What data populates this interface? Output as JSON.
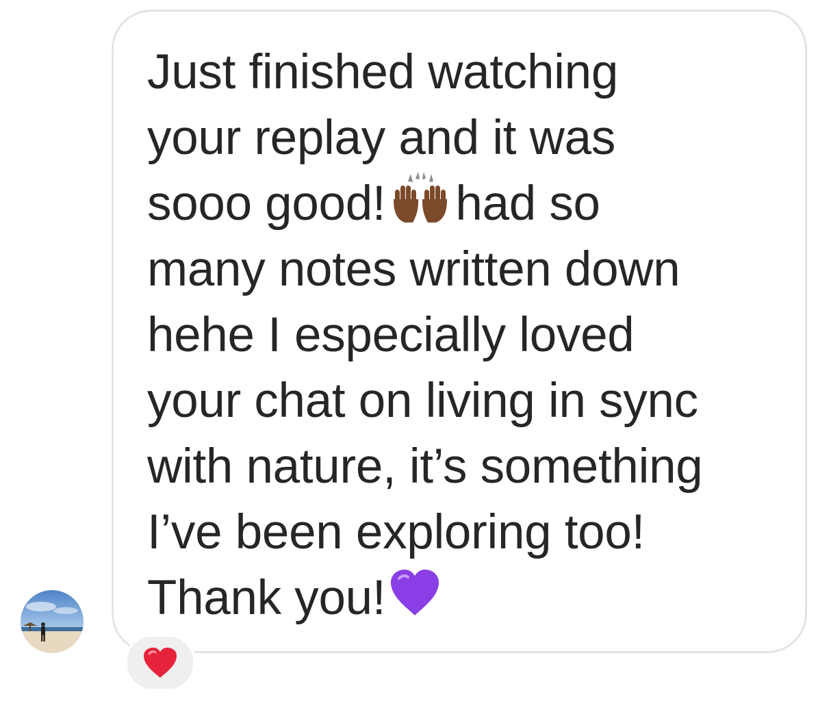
{
  "message": {
    "lines": [
      "Just finished watching",
      "your replay and it was",
      "sooo good!",
      "had so",
      "many notes written down",
      "hehe I especially loved",
      "your chat on living in sync",
      "with nature, it’s something",
      "I’ve been exploring too!",
      "Thank you!"
    ],
    "inline_emoji": [
      "raising-hands-emoji",
      "purple-heart-emoji"
    ]
  },
  "reaction": {
    "emoji": "red-heart-emoji"
  },
  "colors": {
    "text": "#262626",
    "bubble_border": "#e4e4e6",
    "reaction_bg": "#efefef",
    "heart_red": "#e5233a",
    "heart_purple": "#8a3ee6",
    "hands_skin": "#7b4a2a"
  }
}
